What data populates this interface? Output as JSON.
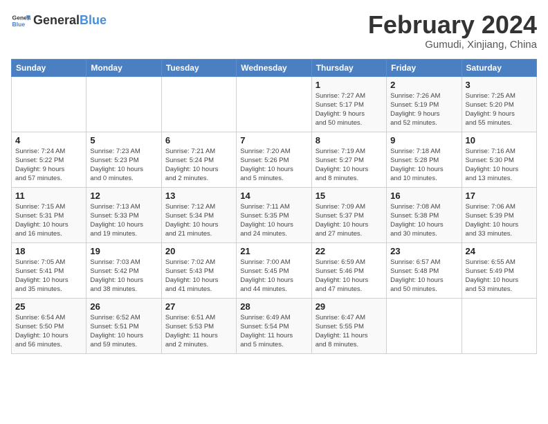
{
  "logo": {
    "text_general": "General",
    "text_blue": "Blue"
  },
  "title": "February 2024",
  "subtitle": "Gumudi, Xinjiang, China",
  "headers": [
    "Sunday",
    "Monday",
    "Tuesday",
    "Wednesday",
    "Thursday",
    "Friday",
    "Saturday"
  ],
  "weeks": [
    [
      {
        "day": "",
        "info": ""
      },
      {
        "day": "",
        "info": ""
      },
      {
        "day": "",
        "info": ""
      },
      {
        "day": "",
        "info": ""
      },
      {
        "day": "1",
        "info": "Sunrise: 7:27 AM\nSunset: 5:17 PM\nDaylight: 9 hours\nand 50 minutes."
      },
      {
        "day": "2",
        "info": "Sunrise: 7:26 AM\nSunset: 5:19 PM\nDaylight: 9 hours\nand 52 minutes."
      },
      {
        "day": "3",
        "info": "Sunrise: 7:25 AM\nSunset: 5:20 PM\nDaylight: 9 hours\nand 55 minutes."
      }
    ],
    [
      {
        "day": "4",
        "info": "Sunrise: 7:24 AM\nSunset: 5:22 PM\nDaylight: 9 hours\nand 57 minutes."
      },
      {
        "day": "5",
        "info": "Sunrise: 7:23 AM\nSunset: 5:23 PM\nDaylight: 10 hours\nand 0 minutes."
      },
      {
        "day": "6",
        "info": "Sunrise: 7:21 AM\nSunset: 5:24 PM\nDaylight: 10 hours\nand 2 minutes."
      },
      {
        "day": "7",
        "info": "Sunrise: 7:20 AM\nSunset: 5:26 PM\nDaylight: 10 hours\nand 5 minutes."
      },
      {
        "day": "8",
        "info": "Sunrise: 7:19 AM\nSunset: 5:27 PM\nDaylight: 10 hours\nand 8 minutes."
      },
      {
        "day": "9",
        "info": "Sunrise: 7:18 AM\nSunset: 5:28 PM\nDaylight: 10 hours\nand 10 minutes."
      },
      {
        "day": "10",
        "info": "Sunrise: 7:16 AM\nSunset: 5:30 PM\nDaylight: 10 hours\nand 13 minutes."
      }
    ],
    [
      {
        "day": "11",
        "info": "Sunrise: 7:15 AM\nSunset: 5:31 PM\nDaylight: 10 hours\nand 16 minutes."
      },
      {
        "day": "12",
        "info": "Sunrise: 7:13 AM\nSunset: 5:33 PM\nDaylight: 10 hours\nand 19 minutes."
      },
      {
        "day": "13",
        "info": "Sunrise: 7:12 AM\nSunset: 5:34 PM\nDaylight: 10 hours\nand 21 minutes."
      },
      {
        "day": "14",
        "info": "Sunrise: 7:11 AM\nSunset: 5:35 PM\nDaylight: 10 hours\nand 24 minutes."
      },
      {
        "day": "15",
        "info": "Sunrise: 7:09 AM\nSunset: 5:37 PM\nDaylight: 10 hours\nand 27 minutes."
      },
      {
        "day": "16",
        "info": "Sunrise: 7:08 AM\nSunset: 5:38 PM\nDaylight: 10 hours\nand 30 minutes."
      },
      {
        "day": "17",
        "info": "Sunrise: 7:06 AM\nSunset: 5:39 PM\nDaylight: 10 hours\nand 33 minutes."
      }
    ],
    [
      {
        "day": "18",
        "info": "Sunrise: 7:05 AM\nSunset: 5:41 PM\nDaylight: 10 hours\nand 35 minutes."
      },
      {
        "day": "19",
        "info": "Sunrise: 7:03 AM\nSunset: 5:42 PM\nDaylight: 10 hours\nand 38 minutes."
      },
      {
        "day": "20",
        "info": "Sunrise: 7:02 AM\nSunset: 5:43 PM\nDaylight: 10 hours\nand 41 minutes."
      },
      {
        "day": "21",
        "info": "Sunrise: 7:00 AM\nSunset: 5:45 PM\nDaylight: 10 hours\nand 44 minutes."
      },
      {
        "day": "22",
        "info": "Sunrise: 6:59 AM\nSunset: 5:46 PM\nDaylight: 10 hours\nand 47 minutes."
      },
      {
        "day": "23",
        "info": "Sunrise: 6:57 AM\nSunset: 5:48 PM\nDaylight: 10 hours\nand 50 minutes."
      },
      {
        "day": "24",
        "info": "Sunrise: 6:55 AM\nSunset: 5:49 PM\nDaylight: 10 hours\nand 53 minutes."
      }
    ],
    [
      {
        "day": "25",
        "info": "Sunrise: 6:54 AM\nSunset: 5:50 PM\nDaylight: 10 hours\nand 56 minutes."
      },
      {
        "day": "26",
        "info": "Sunrise: 6:52 AM\nSunset: 5:51 PM\nDaylight: 10 hours\nand 59 minutes."
      },
      {
        "day": "27",
        "info": "Sunrise: 6:51 AM\nSunset: 5:53 PM\nDaylight: 11 hours\nand 2 minutes."
      },
      {
        "day": "28",
        "info": "Sunrise: 6:49 AM\nSunset: 5:54 PM\nDaylight: 11 hours\nand 5 minutes."
      },
      {
        "day": "29",
        "info": "Sunrise: 6:47 AM\nSunset: 5:55 PM\nDaylight: 11 hours\nand 8 minutes."
      },
      {
        "day": "",
        "info": ""
      },
      {
        "day": "",
        "info": ""
      }
    ]
  ]
}
